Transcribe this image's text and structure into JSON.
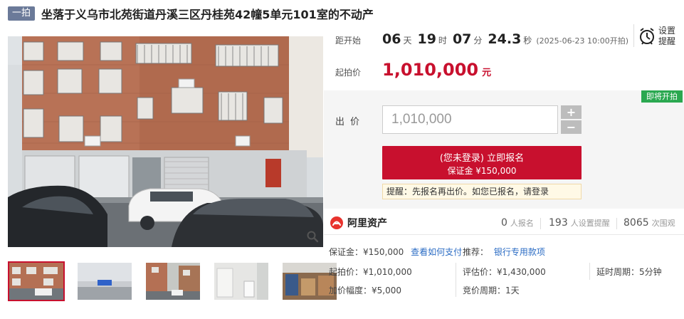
{
  "title": {
    "tag": "一拍",
    "text": "坐落于义乌市北苑街道丹溪三区丹桂苑42幢5单元101室的不动产"
  },
  "countdown": {
    "label": "距开始",
    "days": "06",
    "days_unit": "天",
    "hours": "19",
    "hours_unit": "时",
    "minutes": "07",
    "minutes_unit": "分",
    "seconds": "24.3",
    "seconds_unit": "秒",
    "start_time": "(2025-06-23 10:00开拍)"
  },
  "remind": {
    "label": "设置提醒",
    "icon": "alarm-clock-icon"
  },
  "start_price": {
    "label": "起拍价",
    "value": "1,010,000",
    "unit": "元"
  },
  "bid": {
    "badge": "即将开拍",
    "label": "出价",
    "input_value": "1,010,000",
    "plus": "+",
    "minus": "−",
    "signup_label": "(您未登录) 立即报名",
    "deposit_label": "保证金 ¥150,000",
    "tip": "提醒：先报名再出价。如您已报名，请登录"
  },
  "platform": {
    "name": "阿里资产",
    "signups_count": "0",
    "signups_label": "人报名",
    "reminders_count": "193",
    "reminders_label": "人设置提醒",
    "views_count": "8065",
    "views_label": "次围观"
  },
  "details": {
    "deposit": "保证金：¥150,000",
    "how_to_pay": "查看如何支付",
    "recommend_label": "推荐：",
    "recommend_link": "银行专用款项",
    "start_price": "起拍价：¥1,010,000",
    "assess_price": "评估价：¥1,430,000",
    "delay_period": "延时周期：5分钟",
    "increment": "加价幅度：¥5,000",
    "bid_period": "竞价周期：1天"
  },
  "colors": {
    "accent": "#c8102e",
    "badge_green": "#2aa850",
    "link": "#2b6cc4",
    "tag_bg": "#6b7a99"
  }
}
